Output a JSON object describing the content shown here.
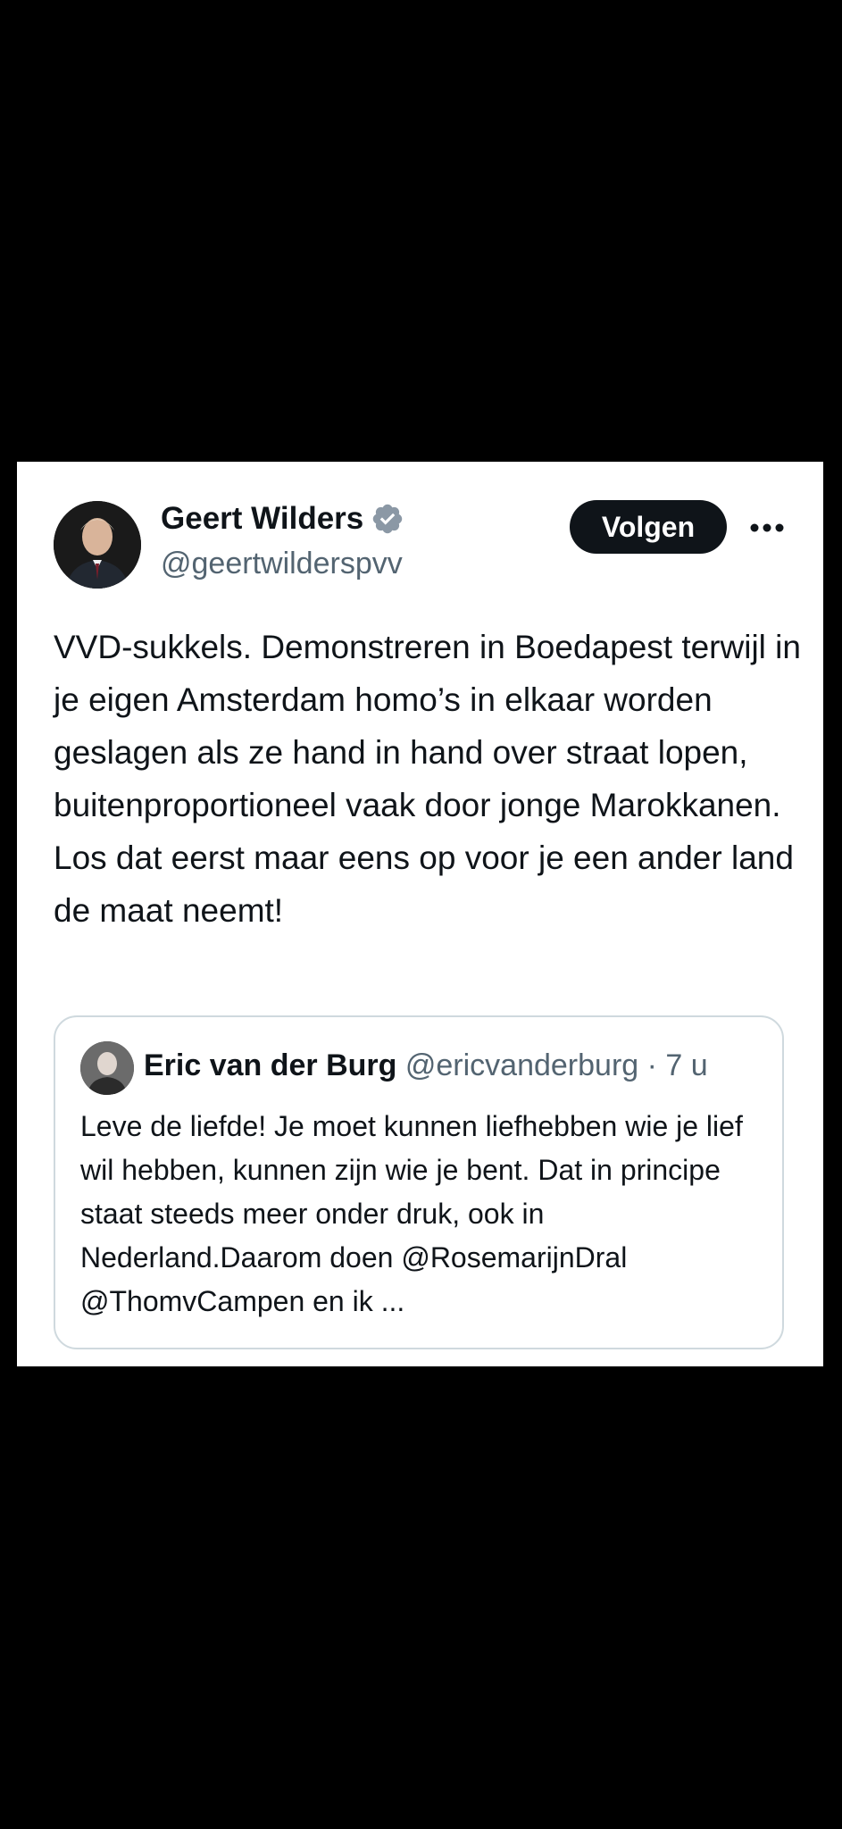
{
  "tweet": {
    "author": {
      "name": "Geert Wilders",
      "handle": "@geertwilderspvv",
      "verified_color": "#8b98a5"
    },
    "follow_label": "Volgen",
    "more_icon": "more-horizontal-icon",
    "text": "VVD-sukkels. Demonstreren in Boedapest terwijl in je eigen Amsterdam homo’s in elkaar worden geslagen als ze hand in hand over straat lopen, buitenproportioneel vaak door jonge Marokkanen. Los dat eerst maar eens op voor je een ander land de maat neemt!",
    "quote": {
      "name": "Eric van der Burg",
      "handle": "@ericvanderburg",
      "separator": "·",
      "time": "7 u",
      "text": "Leve de liefde! Je moet kunnen liefhebben wie je lief wil hebben, kunnen zijn wie je bent. Dat in principe staat steeds meer onder druk, ook in Nederland.Daarom doen @RosemarijnDral @ThomvCampen en ik ..."
    }
  },
  "colors": {
    "background": "#000000",
    "card": "#ffffff",
    "text": "#0f1419",
    "secondary_text": "#536471",
    "border": "#cfd9de",
    "button": "#0f1419"
  }
}
